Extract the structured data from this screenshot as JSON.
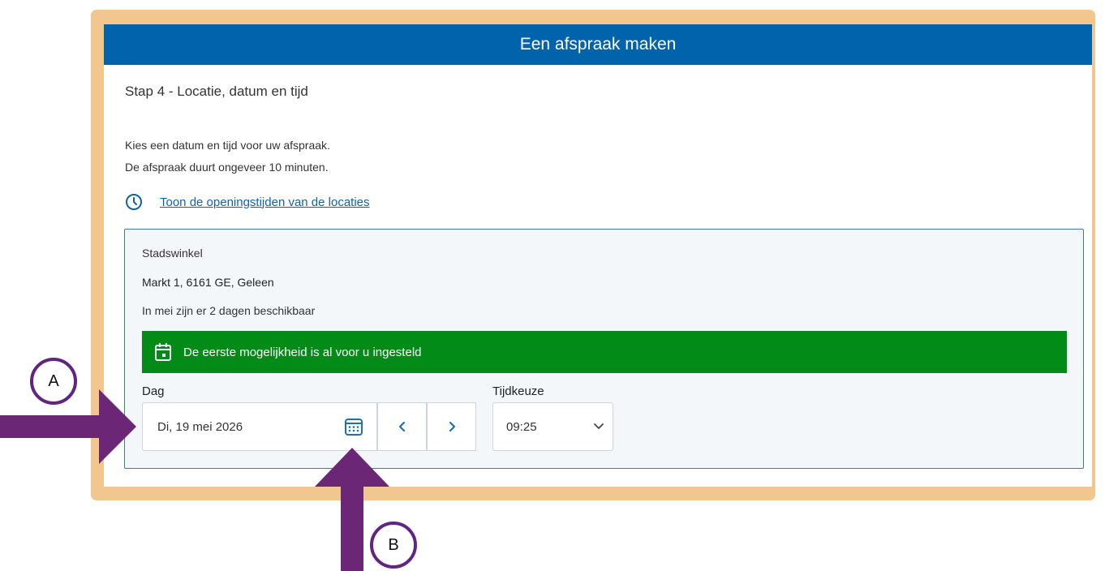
{
  "header": {
    "title": "Een afspraak maken"
  },
  "step": {
    "title": "Stap 4 - Locatie, datum en tijd"
  },
  "intro": {
    "line1": "Kies een datum en tijd voor uw afspraak.",
    "line2": "De afspraak duurt ongeveer 10 minuten."
  },
  "opening_hours_link": {
    "label": "Toon de openingstijden van de locaties",
    "icon": "clock-icon"
  },
  "location": {
    "name": "Stadswinkel",
    "address": "Markt 1, 6161 GE, Geleen",
    "availability": "In mei zijn er 2 dagen beschikbaar"
  },
  "notice": {
    "text": "De eerste mogelijkheid is al voor u ingesteld",
    "icon": "calendar-icon",
    "color": "#028b17"
  },
  "date_field": {
    "label": "Dag",
    "value": "Di, 19 mei 2026",
    "picker_icon": "calendar-grid-icon",
    "prev_icon": "chevron-left-icon",
    "next_icon": "chevron-right-icon"
  },
  "time_field": {
    "label": "Tijdkeuze",
    "value": "09:25",
    "dropdown_icon": "chevron-down-icon"
  },
  "annotations": {
    "marker_a": "A",
    "marker_b": "B",
    "arrow_color": "#6b2676"
  },
  "colors": {
    "header": "#0063ab",
    "frame": "#f1c68f",
    "link": "#0c63b3"
  }
}
